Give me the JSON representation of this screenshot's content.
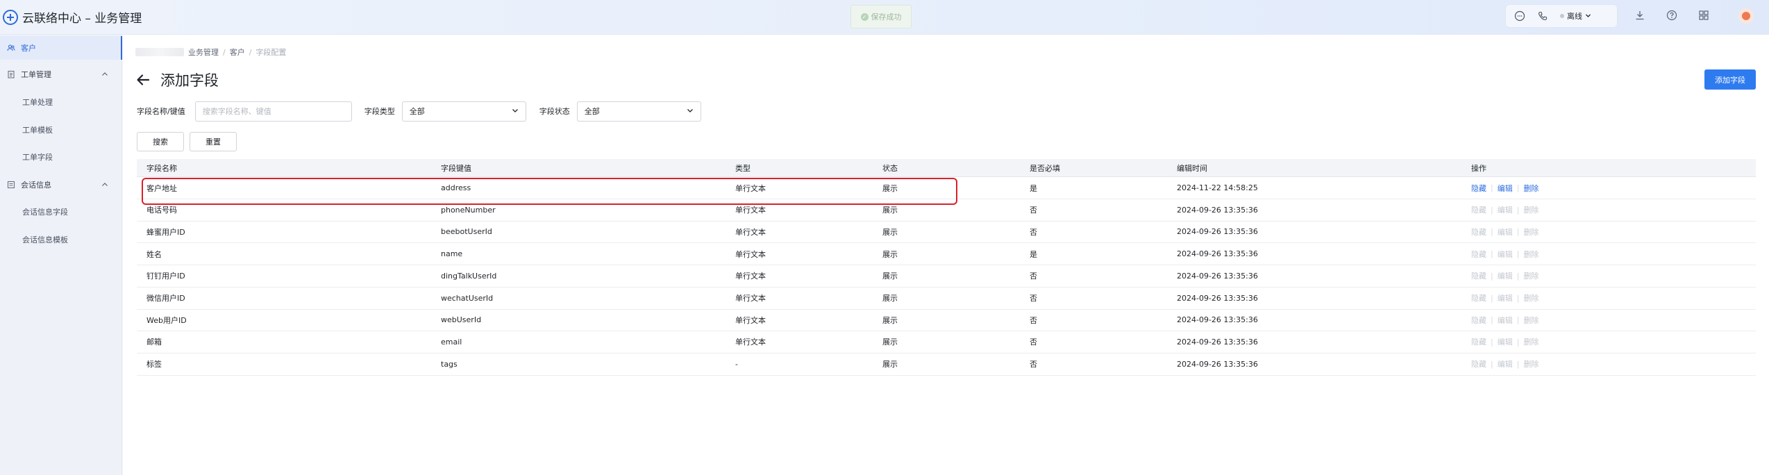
{
  "app": {
    "title": "云联络中心 – 业务管理"
  },
  "toast": {
    "text": "保存成功"
  },
  "header": {
    "status_label": "离线"
  },
  "sidebar": {
    "items": [
      {
        "label": "客户",
        "icon": "users-icon",
        "active": true
      },
      {
        "label": "工单管理",
        "icon": "clipboard-icon",
        "group": true
      },
      {
        "label": "工单处理",
        "sub": true
      },
      {
        "label": "工单模板",
        "sub": true
      },
      {
        "label": "工单字段",
        "sub": true
      },
      {
        "label": "会话信息",
        "icon": "chat-list-icon",
        "group": true
      },
      {
        "label": "会话信息字段",
        "sub": true
      },
      {
        "label": "会话信息模板",
        "sub": true
      }
    ]
  },
  "breadcrumb": [
    "业务管理",
    "客户",
    "字段配置"
  ],
  "page": {
    "title": "添加字段",
    "add_button": "添加字段"
  },
  "filters": {
    "name_label": "字段名称/键值",
    "name_placeholder": "搜索字段名称、键值",
    "type_label": "字段类型",
    "type_value": "全部",
    "status_label": "字段状态",
    "status_value": "全部",
    "search_button": "搜索",
    "reset_button": "重置"
  },
  "table": {
    "columns": [
      "字段名称",
      "字段键值",
      "类型",
      "状态",
      "是否必填",
      "编辑时间",
      "操作"
    ],
    "ops": [
      "隐藏",
      "编辑",
      "删除"
    ],
    "rows": [
      {
        "name": "客户地址",
        "key": "address",
        "type": "单行文本",
        "status": "展示",
        "required": "是",
        "time": "2024-11-22 14:58:25",
        "ops_enabled": true
      },
      {
        "name": "电话号码",
        "key": "phoneNumber",
        "type": "单行文本",
        "status": "展示",
        "required": "否",
        "time": "2024-09-26 13:35:36",
        "ops_enabled": false
      },
      {
        "name": "蜂蜜用户ID",
        "key": "beebotUserId",
        "type": "单行文本",
        "status": "展示",
        "required": "否",
        "time": "2024-09-26 13:35:36",
        "ops_enabled": false
      },
      {
        "name": "姓名",
        "key": "name",
        "type": "单行文本",
        "status": "展示",
        "required": "是",
        "time": "2024-09-26 13:35:36",
        "ops_enabled": false
      },
      {
        "name": "钉钉用户ID",
        "key": "dingTalkUserId",
        "type": "单行文本",
        "status": "展示",
        "required": "否",
        "time": "2024-09-26 13:35:36",
        "ops_enabled": false
      },
      {
        "name": "微信用户ID",
        "key": "wechatUserId",
        "type": "单行文本",
        "status": "展示",
        "required": "否",
        "time": "2024-09-26 13:35:36",
        "ops_enabled": false
      },
      {
        "name": "Web用户ID",
        "key": "webUserId",
        "type": "单行文本",
        "status": "展示",
        "required": "否",
        "time": "2024-09-26 13:35:36",
        "ops_enabled": false
      },
      {
        "name": "邮箱",
        "key": "email",
        "type": "单行文本",
        "status": "展示",
        "required": "否",
        "time": "2024-09-26 13:35:36",
        "ops_enabled": false
      },
      {
        "name": "标签",
        "key": "tags",
        "type": "-",
        "status": "展示",
        "required": "否",
        "time": "2024-09-26 13:35:36",
        "ops_enabled": false
      }
    ]
  },
  "colors": {
    "accent": "#2e7bf0",
    "highlight": "#d8202b"
  }
}
